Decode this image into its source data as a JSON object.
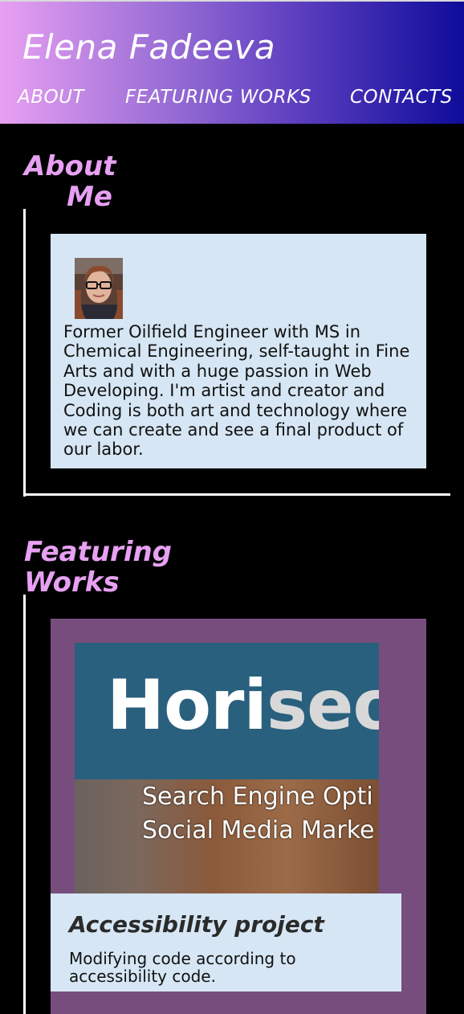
{
  "header": {
    "brand": "Elena Fadeeva",
    "nav": [
      "ABOUT",
      "FEATURING WORKS",
      "CONTACTS"
    ]
  },
  "about": {
    "title_line1": "About",
    "title_line2": "Me",
    "text": "Former Oilfield Engineer with MS in Chemical Engineering, self-taught in Fine Arts and with a huge passion in Web Developing. I'm artist and creator and Coding is both art and technology where we can create and see a final product of our labor."
  },
  "works": {
    "title_line1": "Featuring",
    "title_line2": "Works",
    "project": {
      "thumb_brand_a": "Hori",
      "thumb_brand_b": "seon",
      "thumb_line1": "Search Engine Opti",
      "thumb_line2": "Social Media Marke",
      "title": "Accessibility project",
      "description": "Modifying code according to accessibility code."
    }
  },
  "colors": {
    "accent": "#e7a0f2",
    "card_bg": "#d6e6f4",
    "works_bg": "#764d7d",
    "header_start": "#e7a0f2",
    "header_end": "#0e0c9a"
  }
}
